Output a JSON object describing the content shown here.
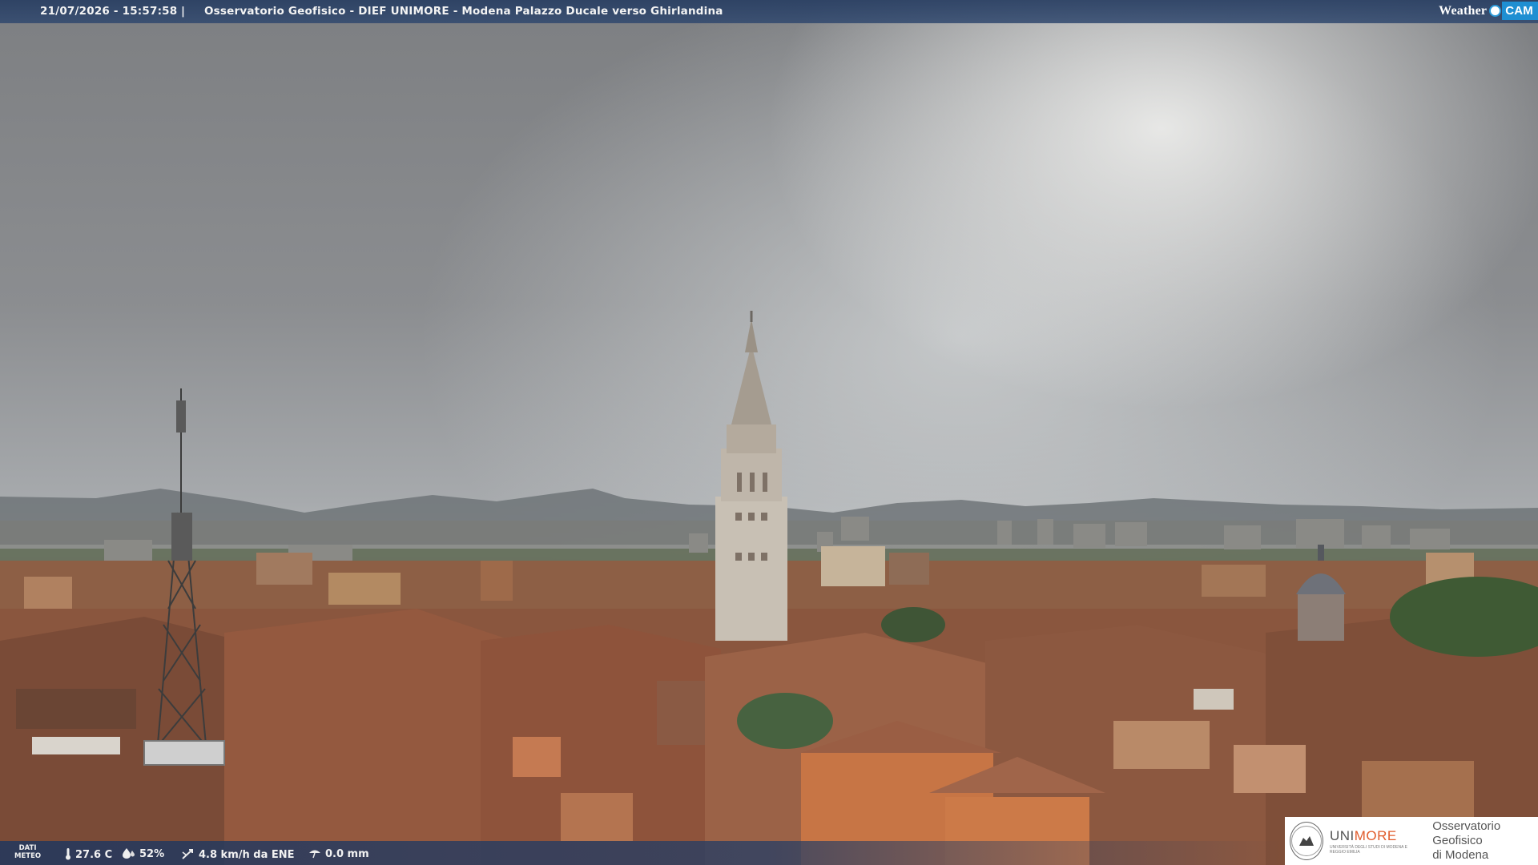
{
  "header": {
    "datetime": "21/07/2026 - 15:57:58",
    "separator": "|",
    "title": "Osservatorio Geofisico - DIEF UNIMORE - Modena Palazzo Ducale verso Ghirlandina"
  },
  "brand": {
    "weather": "Weather",
    "cam": "CAM"
  },
  "meteo": {
    "label_line1": "DATI",
    "label_line2": "METEO",
    "temperature": "27.6 C",
    "humidity": "52%",
    "wind": "4.8 km/h da ENE",
    "rain": "0.0 mm"
  },
  "logo": {
    "uni_prefix": "UNI",
    "uni_suffix": "MORE",
    "uni_sub": "UNIVERSITÀ DEGLI STUDI DI MODENA E REGGIO EMILIA",
    "obs_line1": "Osservatorio Geofisico",
    "obs_line2": "di Modena"
  },
  "colors": {
    "bar": "#2c4672",
    "cam_accent": "#1f8fd2",
    "more_accent": "#e05a2a",
    "roof": "#9a5a3e"
  },
  "icons": [
    "thermometer-icon",
    "humidity-icon",
    "wind-icon",
    "rain-icon"
  ]
}
